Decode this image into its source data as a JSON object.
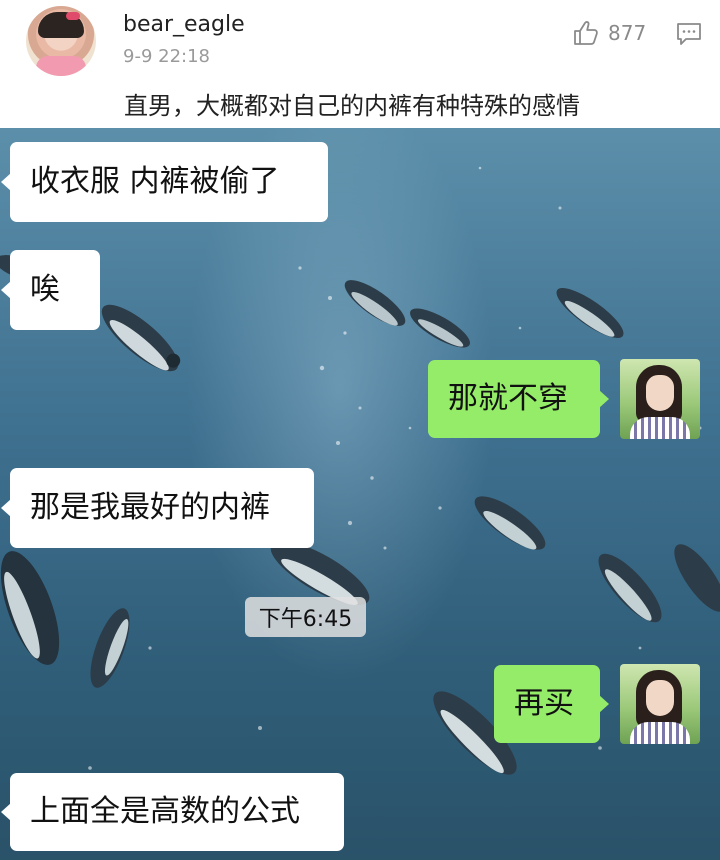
{
  "post": {
    "username": "bear_eagle",
    "timestamp": "9-9 22:18",
    "like_count": "877",
    "comment": "直男，大概都对自己的内裤有种特殊的感情",
    "icons": {
      "like": "thumbs-up-icon",
      "reply": "comment-icon"
    }
  },
  "chat": {
    "messages": [
      {
        "side": "left",
        "text": "收衣服  内裤被偷了"
      },
      {
        "side": "left",
        "text": "唉"
      },
      {
        "side": "right",
        "text": "那就不穿"
      },
      {
        "side": "left",
        "text": "那是我最好的内裤"
      },
      {
        "side": "right",
        "text": "再买"
      },
      {
        "side": "left",
        "text": "上面全是高数的公式"
      }
    ],
    "time_label": "下午6:45"
  },
  "colors": {
    "sent_bubble": "#95ec69",
    "received_bubble": "#ffffff",
    "water_dark": "#2a5269",
    "water_light": "#5c8faa"
  }
}
